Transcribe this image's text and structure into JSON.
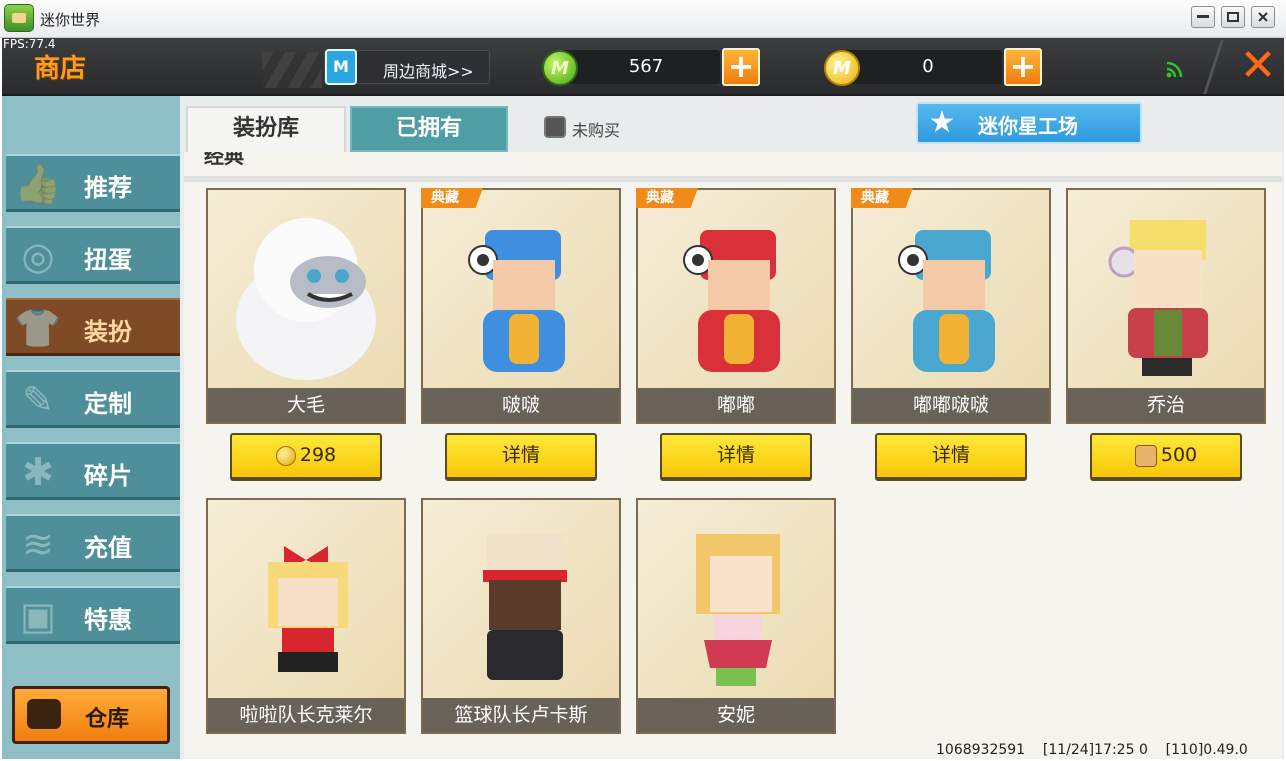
{
  "window": {
    "title": "迷你世界"
  },
  "fps": "FPS:77.4",
  "header": {
    "title": "商店",
    "mall_label": "周边商城>>",
    "mini_coin": "567",
    "gold_coin": "0"
  },
  "sidebar": {
    "items": [
      {
        "label": "推荐",
        "icon": "thumbs-up-icon"
      },
      {
        "label": "扭蛋",
        "icon": "capsule-icon"
      },
      {
        "label": "装扮",
        "icon": "shirt-icon"
      },
      {
        "label": "定制",
        "icon": "pencil-icon"
      },
      {
        "label": "碎片",
        "icon": "puzzle-icon"
      },
      {
        "label": "充值",
        "icon": "coins-icon"
      },
      {
        "label": "特惠",
        "icon": "gift-icon"
      }
    ],
    "warehouse": "仓库"
  },
  "tabs": {
    "wardrobe": "装扮库",
    "owned": "已拥有",
    "not_bought": "未购买",
    "workshop": "迷你星工场"
  },
  "section_title": "经典",
  "badge_label": "典藏",
  "skins": [
    {
      "name": "大毛",
      "button": "298",
      "button_type": "coin",
      "badge": false
    },
    {
      "name": "啵啵",
      "button": "详情",
      "button_type": "detail",
      "badge": true
    },
    {
      "name": "嘟嘟",
      "button": "详情",
      "button_type": "detail",
      "badge": true
    },
    {
      "name": "嘟嘟啵啵",
      "button": "详情",
      "button_type": "detail",
      "badge": true
    },
    {
      "name": "乔治",
      "button": "500",
      "button_type": "token",
      "badge": false
    },
    {
      "name": "啦啦队长克莱尔",
      "badge": false
    },
    {
      "name": "篮球队长卢卡斯",
      "badge": false
    },
    {
      "name": "安妮",
      "badge": false
    }
  ],
  "footer": "1068932591    [11/24]17:25 0    [110]0.49.0",
  "colors": {
    "accent_orange": "#f07d0d",
    "teal": "#4e8f99",
    "active_brown": "#7e4b26",
    "buy_yellow": "#f7c707"
  }
}
